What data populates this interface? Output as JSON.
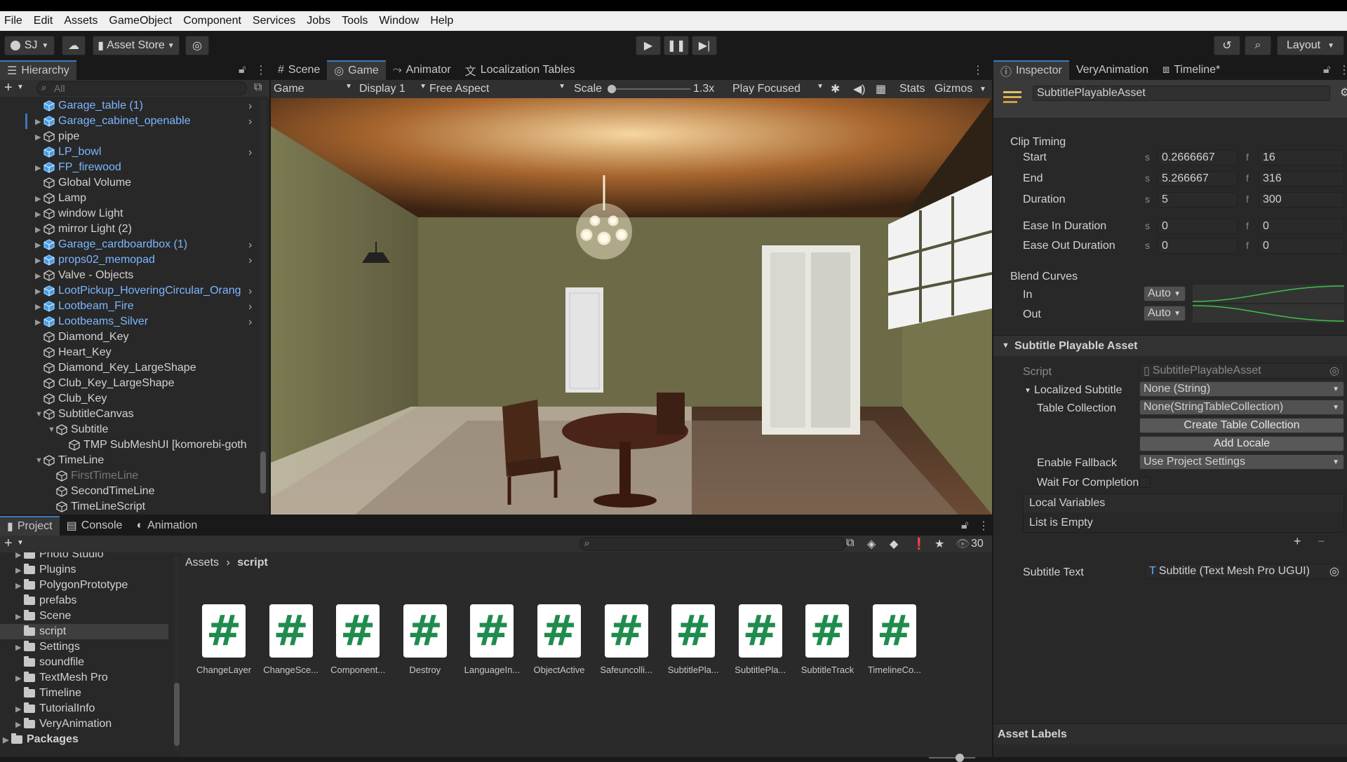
{
  "menu": [
    "File",
    "Edit",
    "Assets",
    "GameObject",
    "Component",
    "Services",
    "Jobs",
    "Tools",
    "Window",
    "Help"
  ],
  "toolbar": {
    "account": "SJ",
    "asset_store": "Asset Store",
    "layout": "Layout"
  },
  "hierarchy": {
    "title": "Hierarchy",
    "search_placeholder": "All",
    "items": [
      {
        "label": "Garage_table (1)",
        "prefab": true,
        "depth": 0,
        "expand": false,
        "child_arrow": true
      },
      {
        "label": "Garage_cabinet_openable",
        "prefab": true,
        "depth": 0,
        "expand": true,
        "child_arrow": true
      },
      {
        "label": "pipe",
        "prefab": false,
        "depth": 0,
        "expand": true,
        "child_arrow": false
      },
      {
        "label": "LP_bowl",
        "prefab": true,
        "depth": 0,
        "expand": false,
        "child_arrow": true
      },
      {
        "label": "FP_firewood",
        "prefab": true,
        "depth": 0,
        "expand": true,
        "child_arrow": false
      },
      {
        "label": "Global Volume",
        "prefab": false,
        "depth": 0,
        "expand": false,
        "child_arrow": false
      },
      {
        "label": "Lamp",
        "prefab": false,
        "depth": 0,
        "expand": true,
        "child_arrow": false
      },
      {
        "label": "window Light",
        "prefab": false,
        "depth": 0,
        "expand": true,
        "child_arrow": false
      },
      {
        "label": "mirror Light (2)",
        "prefab": false,
        "depth": 0,
        "expand": true,
        "child_arrow": false
      },
      {
        "label": "Garage_cardboardbox (1)",
        "prefab": true,
        "depth": 0,
        "expand": true,
        "child_arrow": true
      },
      {
        "label": "props02_memopad",
        "prefab": true,
        "depth": 0,
        "expand": true,
        "child_arrow": true
      },
      {
        "label": "Valve - Objects",
        "prefab": false,
        "depth": 0,
        "expand": true,
        "child_arrow": false
      },
      {
        "label": "LootPickup_HoveringCircular_Orang",
        "prefab": true,
        "depth": 0,
        "expand": true,
        "child_arrow": true
      },
      {
        "label": "Lootbeam_Fire",
        "prefab": true,
        "depth": 0,
        "expand": true,
        "child_arrow": true
      },
      {
        "label": "Lootbeams_Silver",
        "prefab": true,
        "depth": 0,
        "expand": true,
        "child_arrow": true
      },
      {
        "label": "Diamond_Key",
        "prefab": false,
        "depth": 0,
        "expand": false,
        "child_arrow": false
      },
      {
        "label": "Heart_Key",
        "prefab": false,
        "depth": 0,
        "expand": false,
        "child_arrow": false
      },
      {
        "label": "Diamond_Key_LargeShape",
        "prefab": false,
        "depth": 0,
        "expand": false,
        "child_arrow": false
      },
      {
        "label": "Club_Key_LargeShape",
        "prefab": false,
        "depth": 0,
        "expand": false,
        "child_arrow": false
      },
      {
        "label": "Club_Key",
        "prefab": false,
        "depth": 0,
        "expand": false,
        "child_arrow": false
      },
      {
        "label": "SubtitleCanvas",
        "prefab": false,
        "depth": 0,
        "expand": true,
        "open": true,
        "child_arrow": false
      },
      {
        "label": "Subtitle",
        "prefab": false,
        "depth": 1,
        "expand": true,
        "open": true,
        "child_arrow": false
      },
      {
        "label": "TMP SubMeshUI [komorebi-goth",
        "prefab": false,
        "depth": 2,
        "expand": false,
        "child_arrow": false
      },
      {
        "label": "TimeLine",
        "prefab": false,
        "depth": 0,
        "expand": true,
        "open": true,
        "child_arrow": false
      },
      {
        "label": "FirstTimeLine",
        "prefab": false,
        "depth": 1,
        "expand": false,
        "disabled": true,
        "child_arrow": false
      },
      {
        "label": "SecondTimeLine",
        "prefab": false,
        "depth": 1,
        "expand": false,
        "child_arrow": false
      },
      {
        "label": "TimeLineScript",
        "prefab": false,
        "depth": 1,
        "expand": false,
        "child_arrow": false
      }
    ]
  },
  "scene_tabs": [
    "Scene",
    "Game",
    "Animator",
    "Localization Tables"
  ],
  "game_bar": {
    "mode": "Game",
    "display": "Display 1",
    "aspect": "Free Aspect",
    "scale_label": "Scale",
    "scale_value": "1.3x",
    "play_focus": "Play Focused",
    "stats": "Stats",
    "gizmos": "Gizmos"
  },
  "inspector": {
    "tabs": [
      "Inspector",
      "VeryAnimation",
      "Timeline*"
    ],
    "asset_name": "SubtitlePlayableAsset",
    "clip_timing": "Clip Timing",
    "rows": [
      {
        "label": "Start",
        "s": "0.2666667",
        "f": "16"
      },
      {
        "label": "End",
        "s": "5.266667",
        "f": "316"
      },
      {
        "label": "Duration",
        "s": "5",
        "f": "300"
      },
      {
        "label": "Ease In Duration",
        "s": "0",
        "f": "0"
      },
      {
        "label": "Ease Out Duration",
        "s": "0",
        "f": "0"
      }
    ],
    "s_unit": "s",
    "f_unit": "f",
    "blend_curves": "Blend Curves",
    "blend_in": "In",
    "blend_out": "Out",
    "blend_in_value": "Auto",
    "blend_out_value": "Auto",
    "section_title": "Subtitle Playable Asset",
    "script_label": "Script",
    "script_value": "SubtitlePlayableAsset",
    "localized_label": "Localized Subtitle",
    "localized_value": "None (String)",
    "table_label": "Table Collection",
    "table_value": "None(StringTableCollection)",
    "create_table": "Create Table Collection",
    "add_locale": "Add Locale",
    "fallback_label": "Enable Fallback",
    "fallback_value": "Use Project Settings",
    "wait_label": "Wait For Completion",
    "local_vars": "Local Variables",
    "list_empty": "List is Empty",
    "subtitle_text_label": "Subtitle Text",
    "subtitle_text_value": "Subtitle (Text Mesh Pro UGUI)",
    "asset_labels": "Asset Labels"
  },
  "project": {
    "tabs": [
      "Project",
      "Console",
      "Animation"
    ],
    "breadcrumb": [
      "Assets",
      "script"
    ],
    "hidden_count": "30",
    "folders": [
      {
        "label": "Photo Studio",
        "expand": true
      },
      {
        "label": "Plugins",
        "expand": true
      },
      {
        "label": "PolygonPrototype",
        "expand": true
      },
      {
        "label": "prefabs",
        "expand": false
      },
      {
        "label": "Scene",
        "expand": true
      },
      {
        "label": "script",
        "expand": false,
        "selected": true
      },
      {
        "label": "Settings",
        "expand": true
      },
      {
        "label": "soundfile",
        "expand": false
      },
      {
        "label": "TextMesh Pro",
        "expand": true
      },
      {
        "label": "Timeline",
        "expand": false
      },
      {
        "label": "TutorialInfo",
        "expand": true
      },
      {
        "label": "VeryAnimation",
        "expand": true
      }
    ],
    "packages": "Packages",
    "assets": [
      "ChangeLayer",
      "ChangeSce...",
      "Component...",
      "Destroy",
      "LanguageIn...",
      "ObjectActive",
      "Safeuncolli...",
      "SubtitlePla...",
      "SubtitlePla...",
      "SubtitleTrack",
      "TimelineCo..."
    ]
  }
}
